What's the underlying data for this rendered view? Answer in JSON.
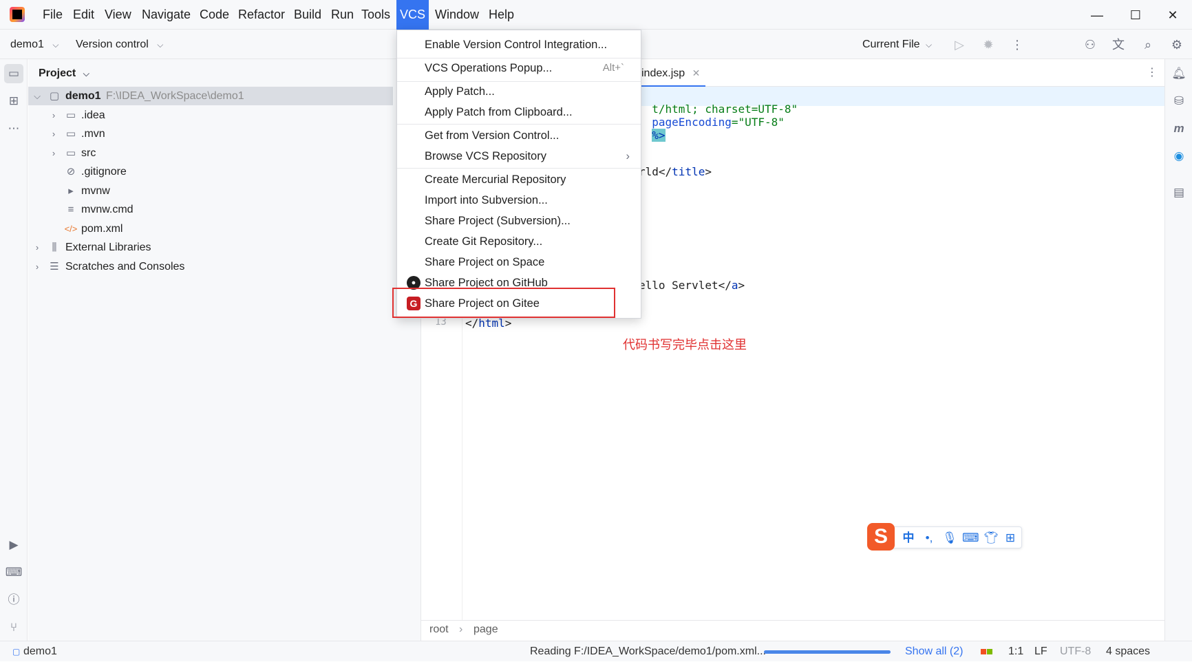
{
  "menubar": {
    "items": [
      "File",
      "Edit",
      "View",
      "Navigate",
      "Code",
      "Refactor",
      "Build",
      "Run",
      "Tools",
      "VCS",
      "Window",
      "Help"
    ],
    "active": "VCS"
  },
  "toolbar": {
    "project": "demo1",
    "vcs": "Version control",
    "run_config": "Current File"
  },
  "project_panel": {
    "title": "Project",
    "tree": [
      {
        "label": "demo1",
        "path": "F:\\IDEA_WorkSpace\\demo1",
        "icon": "module-folder-icon",
        "expanded": true,
        "selected": true
      },
      {
        "label": ".idea",
        "icon": "folder-icon"
      },
      {
        "label": ".mvn",
        "icon": "folder-icon"
      },
      {
        "label": "src",
        "icon": "folder-icon"
      },
      {
        "label": ".gitignore",
        "icon": "ignore-file-icon"
      },
      {
        "label": "mvnw",
        "icon": "shell-script-icon"
      },
      {
        "label": "mvnw.cmd",
        "icon": "text-file-icon"
      },
      {
        "label": "pom.xml",
        "icon": "maven-pom-icon"
      },
      {
        "label": "External Libraries",
        "icon": "library-icon"
      },
      {
        "label": "Scratches and Consoles",
        "icon": "scratches-icon"
      }
    ]
  },
  "editor": {
    "tab": "index.jsp",
    "code": {
      "line1_a": "t/html; charset=UTF-8\"",
      "line1_b": "pageEncoding",
      "line1_c": "=\"UTF-8\"",
      "line1_d": "%>",
      "line2_a": "rld</",
      "line2_b": "title",
      "line2_c": ">",
      "line3_a": "ello Servlet</",
      "line3_b": "a",
      "line3_c": ">",
      "line4_a": "</",
      "line4_b": "html",
      "line4_c": ">"
    },
    "line_number": "13",
    "breadcrumbs": [
      "root",
      "page"
    ]
  },
  "vcs_menu": {
    "items": [
      {
        "label": "Enable Version Control Integration..."
      },
      {
        "label": "VCS Operations Popup...",
        "shortcut": "Alt+`"
      },
      {
        "label": "Apply Patch..."
      },
      {
        "label": "Apply Patch from Clipboard..."
      },
      {
        "label": "Get from Version Control..."
      },
      {
        "label": "Browse VCS Repository",
        "submenu": true
      },
      {
        "label": "Create Mercurial Repository"
      },
      {
        "label": "Import into Subversion..."
      },
      {
        "label": "Share Project (Subversion)..."
      },
      {
        "label": "Create Git Repository..."
      },
      {
        "label": "Share Project on Space"
      },
      {
        "label": "Share Project on GitHub",
        "icon": "github-icon"
      },
      {
        "label": "Share Project on Gitee",
        "icon": "gitee-icon"
      }
    ]
  },
  "annotation": "代码书写完毕点击这里",
  "ime": {
    "mode": "中",
    "punct": "•,"
  },
  "status": {
    "module": "demo1",
    "reading": "Reading F:/IDEA_WorkSpace/demo1/pom.xml...",
    "progress": 1.0,
    "show_all": "Show all (2)",
    "position": "1:1",
    "line_sep": "LF",
    "encoding": "UTF-8",
    "indent": "4 spaces"
  },
  "colors": {
    "accent": "#3574f0",
    "highlight": "#e03131",
    "gitee": "#c71d23"
  }
}
